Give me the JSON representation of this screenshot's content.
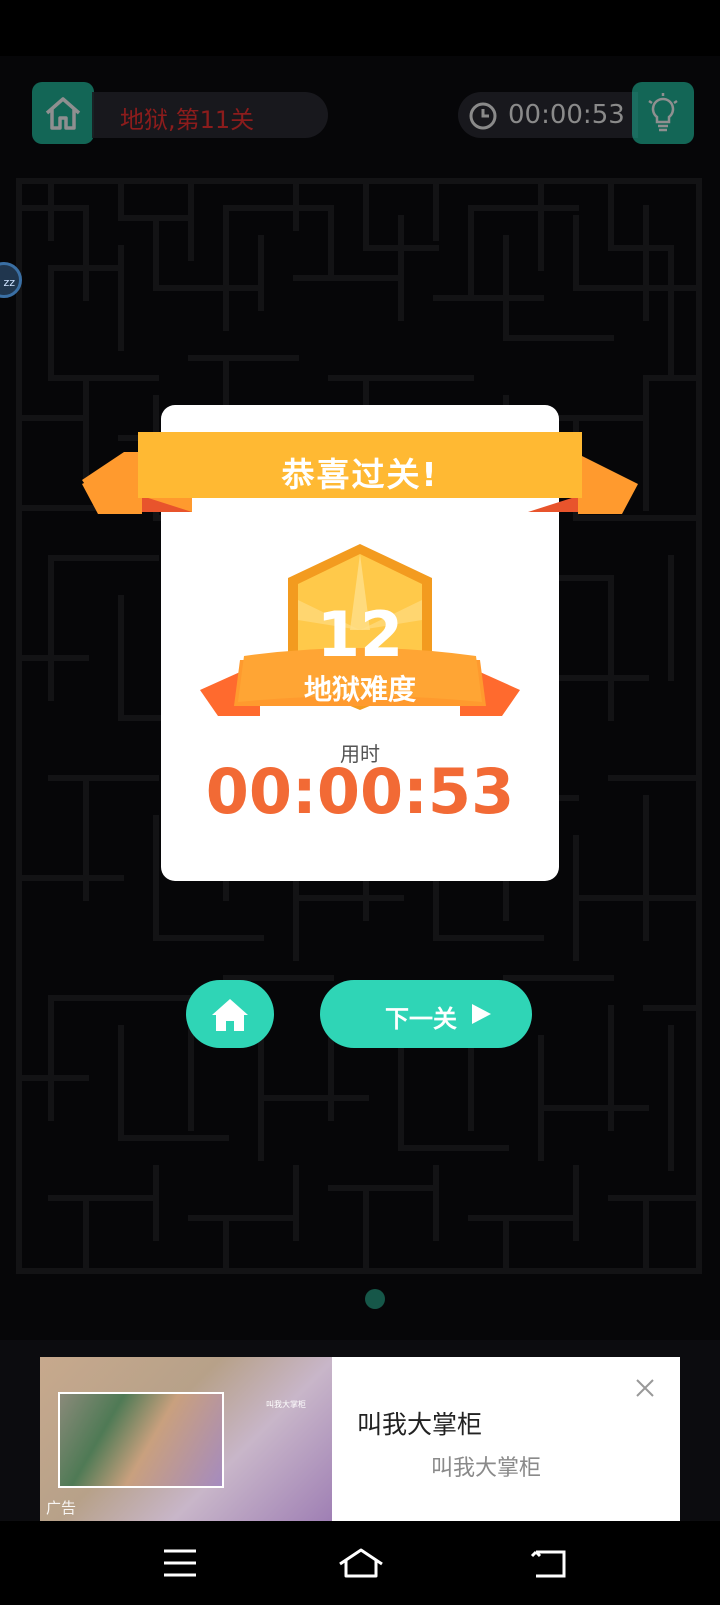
{
  "header": {
    "level_text": "地狱,第11关",
    "timer_text": "00:00:53"
  },
  "side_bubble": {
    "text": "zz"
  },
  "result": {
    "banner": "恭喜过关!",
    "badge_number": "12",
    "badge_label": "地狱难度",
    "time_label": "用时",
    "time_value": "00:00:53"
  },
  "actions": {
    "next_label": "下一关"
  },
  "ad": {
    "title": "叫我大掌柜",
    "subtitle": "叫我大掌柜",
    "tag": "广告",
    "mini_title": "叫我大掌柜"
  },
  "colors": {
    "accent": "#2fd5b6",
    "ribbon": "#ffb933",
    "time": "#f26a35"
  }
}
